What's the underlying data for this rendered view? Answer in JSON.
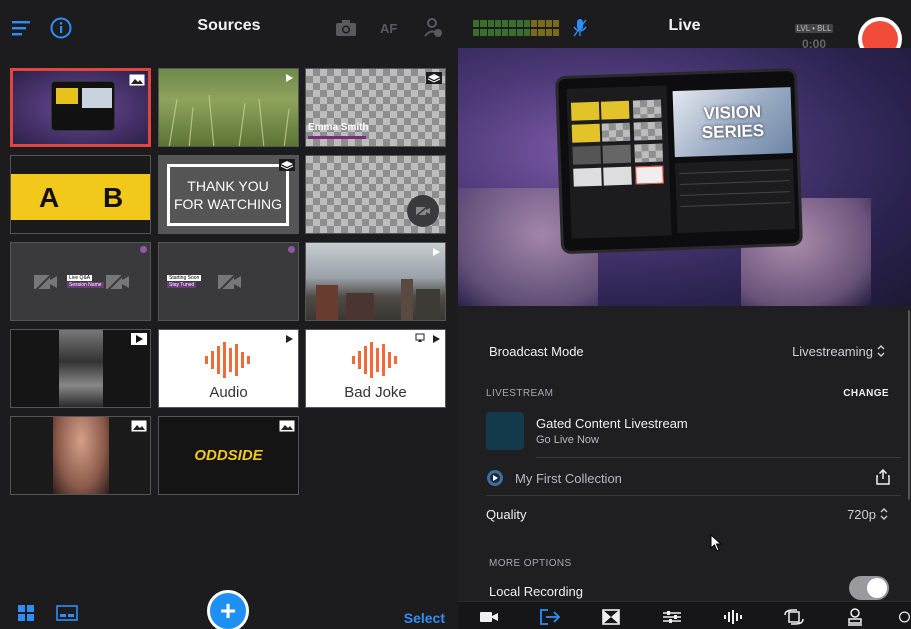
{
  "sources": {
    "title": "Sources",
    "select_label": "Select",
    "tiles": [
      {
        "caption": ""
      },
      {
        "caption": ""
      },
      {
        "caption": "Emma Smith"
      },
      {
        "a": "A",
        "b": "B"
      },
      {
        "line1": "THANK YOU",
        "line2": "FOR WATCHING"
      },
      {
        "caption": ""
      },
      {
        "lower_third_1": "Live Q&A",
        "lower_third_2": "Session Name"
      },
      {
        "lower_third_1": "Starting Soon",
        "lower_third_2": "Stay Tuned"
      },
      {
        "caption": ""
      },
      {
        "caption": ""
      },
      {
        "caption": "Audio"
      },
      {
        "caption": "Bad Joke"
      },
      {
        "caption": ""
      },
      {
        "caption": "ODDSIDE"
      }
    ]
  },
  "live": {
    "title": "Live",
    "level_tag": "LVL • BLL",
    "timer": "0:00",
    "preview_overlay": {
      "line1": "VISION",
      "line2": "SERIES"
    },
    "broadcast_mode": {
      "label": "Broadcast Mode",
      "value": "Livestreaming"
    },
    "livestream": {
      "section": "LIVESTREAM",
      "change": "CHANGE",
      "name": "Gated Content Livestream",
      "status": "Go Live Now",
      "collection": "My First Collection"
    },
    "quality": {
      "label": "Quality",
      "value": "720p"
    },
    "more_options": "MORE OPTIONS",
    "local_recording": {
      "label": "Local Recording",
      "enabled": true
    }
  },
  "colors": {
    "accent": "#2f8ef5",
    "record": "#f24b3a",
    "selected_border": "#e2453c",
    "audio_wave": "#f06a3a"
  }
}
